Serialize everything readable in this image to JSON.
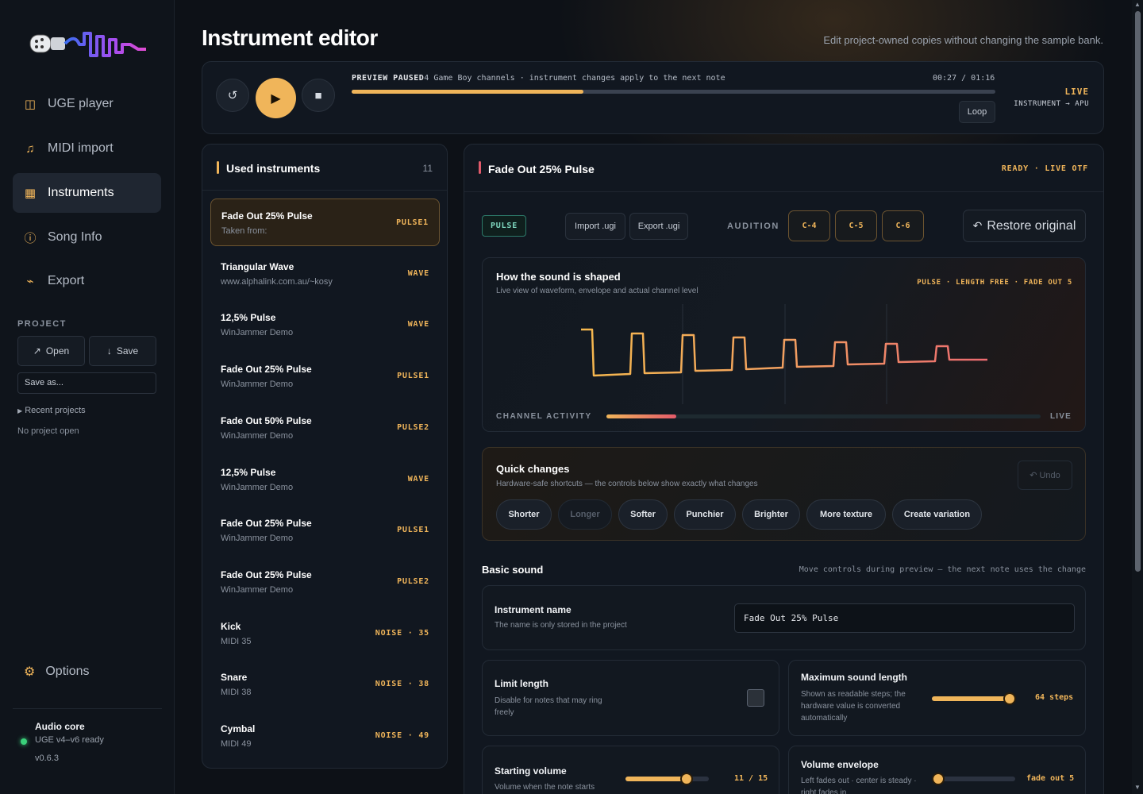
{
  "sidebar": {
    "nav": [
      {
        "label": "UGE player",
        "icon": "columns-icon"
      },
      {
        "label": "MIDI import",
        "icon": "music-note-icon"
      },
      {
        "label": "Instruments",
        "icon": "grid-icon"
      },
      {
        "label": "Song Info",
        "icon": "info-icon"
      },
      {
        "label": "Export",
        "icon": "export-icon"
      }
    ],
    "active_nav": "Instruments",
    "project_heading": "PROJECT",
    "open_label": "Open",
    "save_label": "Save",
    "save_as_label": "Save as...",
    "recent_projects_label": "Recent projects",
    "no_project_label": "No project open",
    "options_label": "Options",
    "audio_core": {
      "title": "Audio core",
      "status": "UGE v4–v6 ready",
      "version": "v0.6.3"
    }
  },
  "header": {
    "title": "Instrument editor",
    "subtitle": "Edit project-owned copies without changing the sample bank."
  },
  "transport": {
    "preview_state": "PREVIEW PAUSED",
    "preview_info": "4 Game Boy channels · instrument changes apply to the next note",
    "time": "00:27 / 01:16",
    "progress": 0.36,
    "loop_label": "Loop",
    "live_tag": "LIVE",
    "live_sub": "INSTRUMENT → APU"
  },
  "instruments": {
    "title": "Used instruments",
    "count": "11",
    "items": [
      {
        "name": "Fade Out 25% Pulse",
        "sub": "Taken from:",
        "type": "PULSE1",
        "selected": true
      },
      {
        "name": "Triangular Wave",
        "sub": "www.alphalink.com.au/~kosy",
        "type": "WAVE"
      },
      {
        "name": "12,5% Pulse",
        "sub": "WinJammer Demo",
        "type": "WAVE"
      },
      {
        "name": "Fade Out 25% Pulse",
        "sub": "WinJammer Demo",
        "type": "PULSE1"
      },
      {
        "name": "Fade Out 50% Pulse",
        "sub": "WinJammer Demo",
        "type": "PULSE2"
      },
      {
        "name": "12,5% Pulse",
        "sub": "WinJammer Demo",
        "type": "WAVE"
      },
      {
        "name": "Fade Out 25% Pulse",
        "sub": "WinJammer Demo",
        "type": "PULSE1"
      },
      {
        "name": "Fade Out 25% Pulse",
        "sub": "WinJammer Demo",
        "type": "PULSE2"
      },
      {
        "name": "Kick",
        "sub": "MIDI 35",
        "type": "NOISE · 35"
      },
      {
        "name": "Snare",
        "sub": "MIDI 38",
        "type": "NOISE · 38"
      },
      {
        "name": "Cymbal",
        "sub": "MIDI 49",
        "type": "NOISE · 49"
      }
    ]
  },
  "editor": {
    "title": "Fade Out 25% Pulse",
    "status": "READY · LIVE OTF",
    "kind_pill": "PULSE",
    "import_label": "Import .ugi",
    "export_label": "Export .ugi",
    "audition_label": "AUDITION",
    "notes": [
      "C-4",
      "C-5",
      "C-6"
    ],
    "restore_label": "Restore original",
    "shape": {
      "title": "How the sound is shaped",
      "subtitle": "Live view of waveform, envelope and actual channel level",
      "tags": "PULSE · LENGTH FREE · FADE OUT 5",
      "channel_label": "CHANNEL ACTIVITY",
      "channel_level": 0.16,
      "channel_live": "LIVE"
    },
    "quick": {
      "title": "Quick changes",
      "subtitle": "Hardware-safe shortcuts — the controls below show exactly what changes",
      "undo_label": "Undo",
      "buttons": [
        {
          "label": "Shorter",
          "enabled": true
        },
        {
          "label": "Longer",
          "enabled": false
        },
        {
          "label": "Softer",
          "enabled": true
        },
        {
          "label": "Punchier",
          "enabled": true
        },
        {
          "label": "Brighter",
          "enabled": true
        },
        {
          "label": "More texture",
          "enabled": true
        },
        {
          "label": "Create variation",
          "enabled": true
        }
      ]
    },
    "basic": {
      "title": "Basic sound",
      "hint": "Move controls during preview — the next note uses the change",
      "name_title": "Instrument name",
      "name_sub": "The name is only stored in the project",
      "name_value": "Fade Out 25% Pulse",
      "limit_title": "Limit length",
      "limit_sub": "Disable for notes that may ring freely",
      "limit_checked": false,
      "maxlen_title": "Maximum sound length",
      "maxlen_sub": "Shown as readable steps; the hardware value is converted automatically",
      "maxlen_value": "64 steps",
      "maxlen_fraction": 1.0,
      "startvol_title": "Starting volume",
      "startvol_sub": "Volume when the note starts",
      "startvol_value": "11 / 15",
      "startvol_fraction": 0.733,
      "env_title": "Volume envelope",
      "env_sub": "Left fades out · center is steady · right fades in",
      "env_value": "fade out 5",
      "env_fraction": 0.08
    }
  },
  "colors": {
    "accent": "#f0b55a",
    "background": "#0d1117",
    "panel": "#111720",
    "status_ok": "#3ad07a"
  }
}
